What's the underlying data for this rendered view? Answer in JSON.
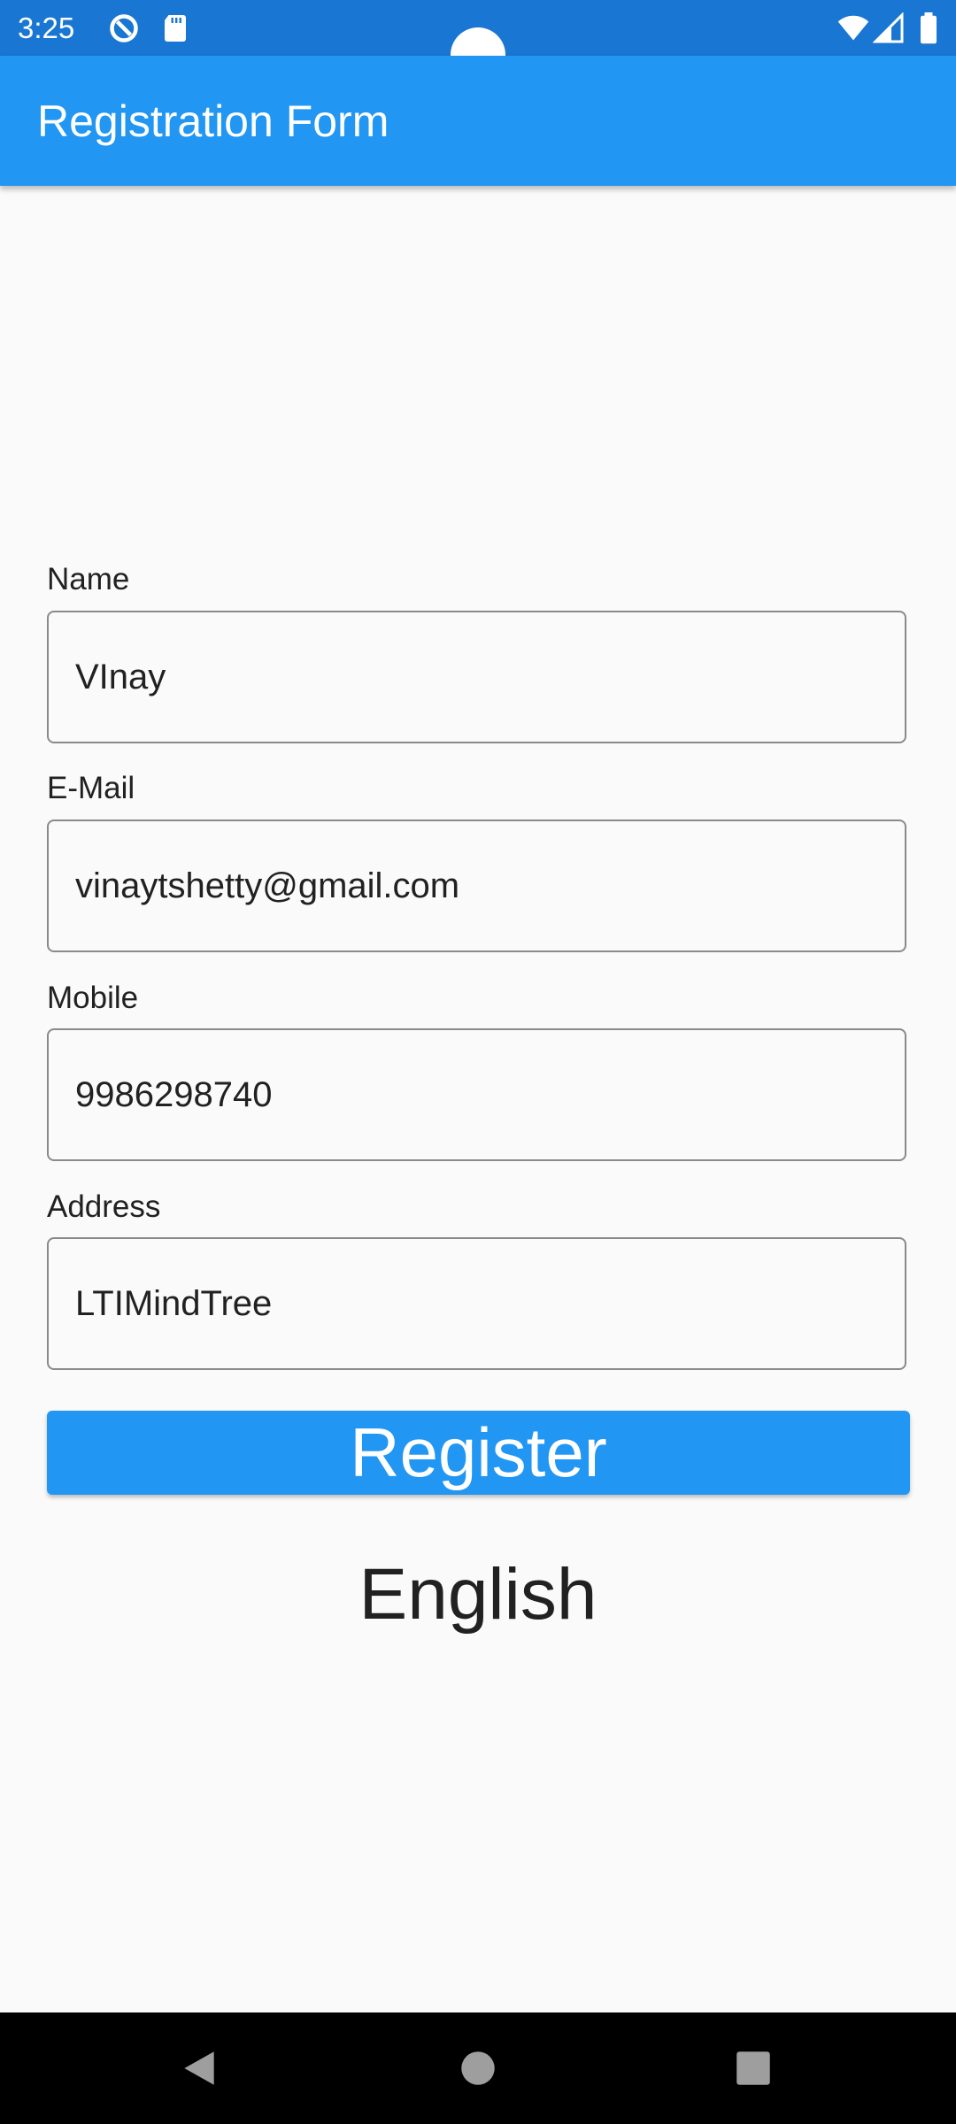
{
  "status_bar": {
    "time": "3:25",
    "icons_left": [
      "do-not-disturb-icon",
      "sd-card-icon"
    ],
    "icons_right": [
      "wifi-icon",
      "cell-signal-icon",
      "battery-icon"
    ]
  },
  "app_bar": {
    "title": "Registration Form"
  },
  "form": {
    "name_label": "Name",
    "name_value": "VInay",
    "email_label": "E-Mail",
    "email_value": "vinaytshetty@gmail.com",
    "mobile_label": "Mobile",
    "mobile_value": "9986298740",
    "address_label": "Address",
    "address_value": "LTIMindTree"
  },
  "register_button": {
    "label": "Register"
  },
  "language": {
    "text": "English"
  },
  "nav_bar": {
    "buttons": [
      "back-icon",
      "home-icon",
      "recents-icon"
    ]
  },
  "colors": {
    "status_bar": "#1976d2",
    "app_bar": "#2196f3",
    "background": "#fafafa",
    "button": "#2196f3"
  }
}
